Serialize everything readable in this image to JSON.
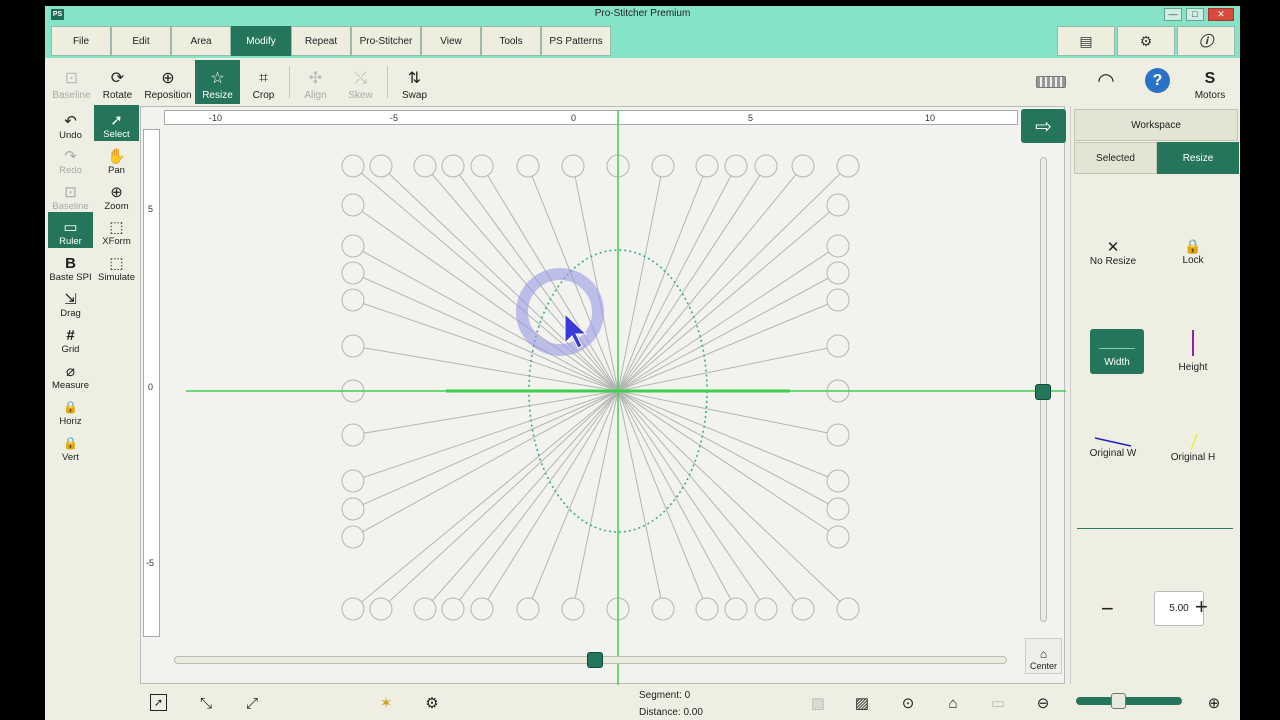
{
  "window": {
    "title": "Pro-Stitcher Premium",
    "app_icon": "PS",
    "minimize": "—",
    "maximize": "□",
    "close": "✕"
  },
  "menu": {
    "tabs": [
      {
        "label": "File"
      },
      {
        "label": "Edit"
      },
      {
        "label": "Area"
      },
      {
        "label": "Modify"
      },
      {
        "label": "Repeat"
      },
      {
        "label": "Pro-Stitcher"
      },
      {
        "label": "View"
      },
      {
        "label": "Tools"
      },
      {
        "label": "PS Patterns"
      }
    ],
    "active_tab": "Modify",
    "right_icons": [
      "book-icon",
      "gear-icon",
      "info-icon"
    ]
  },
  "toolbar": {
    "items": [
      {
        "label": "Baseline",
        "icon": "⊡",
        "state": "disabled"
      },
      {
        "label": "Rotate",
        "icon": "⟳",
        "state": "normal"
      },
      {
        "label": "Reposition",
        "icon": "⊕",
        "state": "normal"
      },
      {
        "label": "Resize",
        "icon": "☆",
        "state": "active"
      },
      {
        "label": "Crop",
        "icon": "⌗",
        "state": "normal"
      },
      {
        "label": "Align",
        "icon": "✣",
        "state": "disabled"
      },
      {
        "label": "Skew",
        "icon": "⤯",
        "state": "disabled"
      },
      {
        "label": "Swap",
        "icon": "⇅",
        "state": "normal"
      }
    ],
    "motors_label": "Motors",
    "motors_icon": "S",
    "help_icon": "?",
    "wifi_icon": "wifi-icon",
    "keyboard_icon": "keyboard-icon"
  },
  "left_tools": [
    {
      "label": "Undo",
      "icon": "↶",
      "state": "normal"
    },
    {
      "label": "Select",
      "icon": "➚",
      "state": "active"
    },
    {
      "label": "Redo",
      "icon": "↷",
      "state": "disabled"
    },
    {
      "label": "Pan",
      "icon": "✋",
      "state": "normal"
    },
    {
      "label": "Baseline",
      "icon": "⊡",
      "state": "disabled"
    },
    {
      "label": "Zoom",
      "icon": "⊕",
      "state": "normal"
    },
    {
      "label": "Ruler",
      "icon": "📏",
      "state": "active"
    },
    {
      "label": "XForm",
      "icon": "⬚",
      "state": "normal"
    },
    {
      "label": "Baste SPI",
      "icon": "B",
      "state": "normal"
    },
    {
      "label": "Simulate",
      "icon": "⬚",
      "state": "normal"
    },
    {
      "label": "Drag",
      "icon": "⇲",
      "state": "normal"
    },
    {
      "label": "Grid",
      "icon": "#",
      "state": "normal"
    },
    {
      "label": "Measure",
      "icon": "⌀",
      "state": "normal"
    },
    {
      "label": "Horiz",
      "icon": "🔒",
      "state": "normal"
    },
    {
      "label": "Vert",
      "icon": "🔒",
      "state": "normal"
    }
  ],
  "rulers": {
    "horizontal": [
      "-10",
      "-5",
      "0",
      "5",
      "10"
    ],
    "vertical": [
      "5",
      "0",
      "-5"
    ]
  },
  "scroll": {
    "horizontal_position": 0.51,
    "vertical_position": 0.51
  },
  "center_label": "Center",
  "panel": {
    "workspace_label": "Workspace",
    "tab_selected": "Selected",
    "tab_resize": "Resize",
    "no_resize_label": "No Resize",
    "lock_label": "Lock",
    "width_label": "Width",
    "height_label": "Height",
    "original_w_label": "Original W",
    "original_h_label": "Original H",
    "value": "5.00",
    "minus": "−",
    "plus": "+",
    "colors": {
      "height": "#8a2a9a",
      "original_w": "#2020c0",
      "original_h": "#ecec40"
    }
  },
  "status": {
    "segment_label": "Segment:",
    "segment_value": "0",
    "distance_label": "Distance:",
    "distance_value": "0.00",
    "zoom_level": 0.4
  },
  "colors": {
    "accent": "#25745c",
    "menubar": "#85e3c7",
    "guide": "#3fcf4f"
  }
}
